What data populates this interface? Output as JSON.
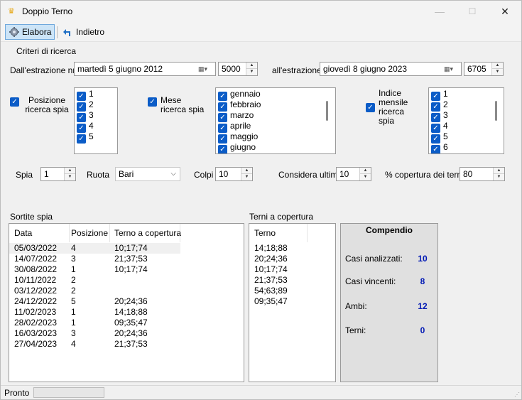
{
  "window": {
    "title": "Doppio Terno",
    "minimize": "—",
    "maximize": "☐",
    "close": "✕"
  },
  "toolbar": {
    "elabora_label": "Elabora",
    "indietro_label": "Indietro"
  },
  "criteria": {
    "group_title": "Criteri di ricerca",
    "from_label": "Dall'estrazione nr.",
    "from_date": "martedì     5   giugno    2012",
    "from_number": "5000",
    "to_label": "all'estrazione",
    "to_date": "giovedì     8   giugno    2023",
    "to_number": "6705",
    "position_label": "Posizione ricerca spia",
    "position_items": [
      "1",
      "2",
      "3",
      "4",
      "5"
    ],
    "month_label": "Mese ricerca spia",
    "month_items": [
      "gennaio",
      "febbraio",
      "marzo",
      "aprile",
      "maggio",
      "giugno"
    ],
    "index_label": "Indice mensile ricerca spia",
    "index_items": [
      "1",
      "2",
      "3",
      "4",
      "5",
      "6"
    ],
    "spia_label": "Spia",
    "spia_value": "1",
    "ruota_label": "Ruota",
    "ruota_value": "Bari",
    "colpi_label": "Colpi",
    "colpi_value": "10",
    "considera_label": "Considera ultimi",
    "considera_value": "10",
    "copertura_label": "% copertura dei terni",
    "copertura_value": "80"
  },
  "sortite": {
    "title": "Sortite spia",
    "headers": [
      "Data",
      "Posizione",
      "Terno a copertura"
    ],
    "rows": [
      [
        "05/03/2022",
        "4",
        "10;17;74"
      ],
      [
        "14/07/2022",
        "3",
        "21;37;53"
      ],
      [
        "30/08/2022",
        "1",
        "10;17;74"
      ],
      [
        "10/11/2022",
        "2",
        ""
      ],
      [
        "03/12/2022",
        "2",
        ""
      ],
      [
        "24/12/2022",
        "5",
        "20;24;36"
      ],
      [
        "11/02/2023",
        "1",
        "14;18;88"
      ],
      [
        "28/02/2023",
        "1",
        "09;35;47"
      ],
      [
        "16/03/2023",
        "3",
        "20;24;36"
      ],
      [
        "27/04/2023",
        "4",
        "21;37;53"
      ]
    ]
  },
  "terni": {
    "title": "Terni a copertura",
    "header": "Terno",
    "rows": [
      "14;18;88",
      "20;24;36",
      "10;17;74",
      "21;37;53",
      "54;63;89",
      "09;35;47"
    ]
  },
  "compendio": {
    "title": "Compendio",
    "casi_analizzati_label": "Casi analizzati:",
    "casi_analizzati": "10",
    "casi_vincenti_label": "Casi vincenti:",
    "casi_vincenti": "8",
    "ambi_label": "Ambi:",
    "ambi": "12",
    "terni_label": "Terni:",
    "terni": "0"
  },
  "status": {
    "text": "Pronto"
  },
  "colors": {
    "accent": "#0b5cc7",
    "value_blue": "#0018b4"
  }
}
